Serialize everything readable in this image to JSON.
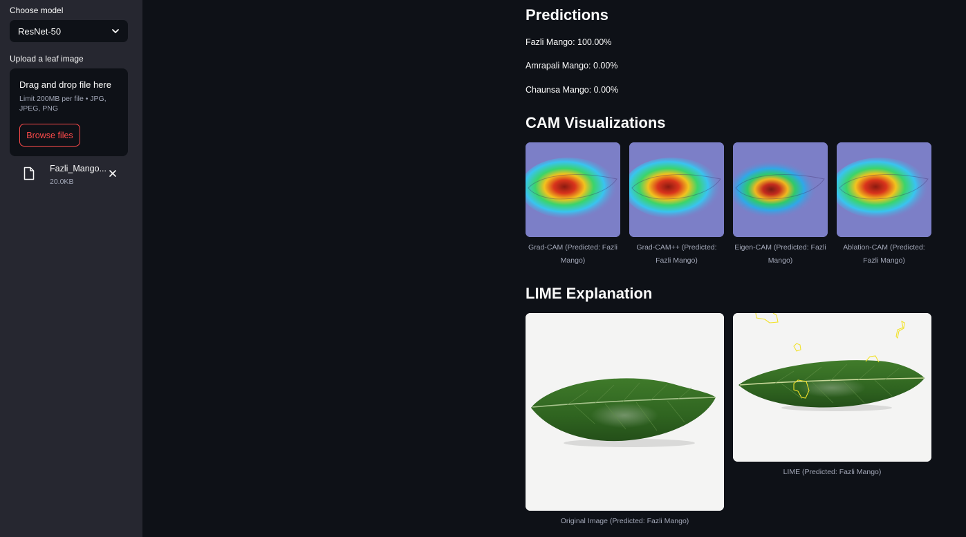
{
  "sidebar": {
    "model_label": "Choose model",
    "model_value": "ResNet-50",
    "upload_label": "Upload a leaf image",
    "dropzone_title": "Drag and drop file here",
    "dropzone_limit": "Limit 200MB per file • JPG, JPEG, PNG",
    "browse_label": "Browse files",
    "file": {
      "name": "Fazli_Mango...",
      "size": "20.0KB"
    }
  },
  "main": {
    "predictions_title": "Predictions",
    "predictions": [
      "Fazli Mango: 100.00%",
      "Amrapali Mango: 0.00%",
      "Chaunsa Mango: 0.00%"
    ],
    "cam_title": "CAM Visualizations",
    "cam_captions": [
      "Grad-CAM (Predicted: Fazli Mango)",
      "Grad-CAM++ (Predicted: Fazli Mango)",
      "Eigen-CAM (Predicted: Fazli Mango)",
      "Ablation-CAM (Predicted: Fazli Mango)"
    ],
    "lime_title": "LIME Explanation",
    "lime_captions": [
      "Original Image (Predicted: Fazli Mango)",
      "LIME (Predicted: Fazli Mango)"
    ]
  },
  "colors": {
    "app_bg": "#0e1117",
    "sidebar_bg": "#262730",
    "accent": "#ff4b4b",
    "caption": "#a3a8b8"
  },
  "icons": [
    "chevron-down-icon",
    "file-icon",
    "close-icon"
  ]
}
